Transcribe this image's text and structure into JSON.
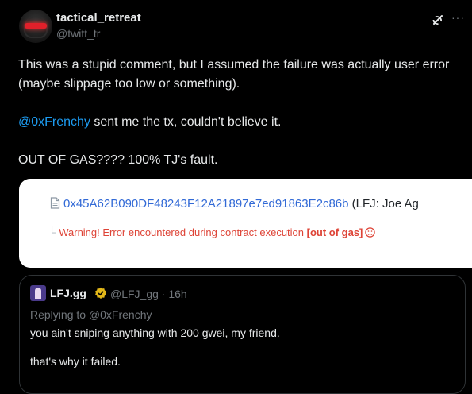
{
  "author": {
    "display_name": "tactical_retreat",
    "handle": "@twitt_tr"
  },
  "tweet": {
    "line1": "This was a stupid comment, but I assumed the failure was actually user error (maybe slippage too low or something).",
    "mention": "@0xFrenchy",
    "line2_rest": " sent me the tx, couldn't believe it.",
    "line3": "OUT OF GAS???? 100% TJ's fault."
  },
  "media": {
    "tx_hash": "0x45A62B090DF48243F12A21897e7ed91863E2c86b",
    "tx_label": " (LFJ: Joe Ag",
    "warning_prefix": "Warning! Error encountered during contract execution ",
    "warning_bold": "[out of gas]"
  },
  "quote": {
    "display_name": "LFJ.gg",
    "meta": "@LFJ_gg · 16h",
    "replying": "Replying to @0xFrenchy",
    "line1": "you ain't sniping anything with 200 gwei, my friend.",
    "line2": "that's why it failed."
  },
  "colors": {
    "accent": "#1d9bf0",
    "warning": "#de4437",
    "verified_gold": "#e2b719"
  },
  "icons": [
    "grok-icon",
    "more-icon",
    "document-icon",
    "sad-face-icon",
    "verified-badge-icon"
  ]
}
